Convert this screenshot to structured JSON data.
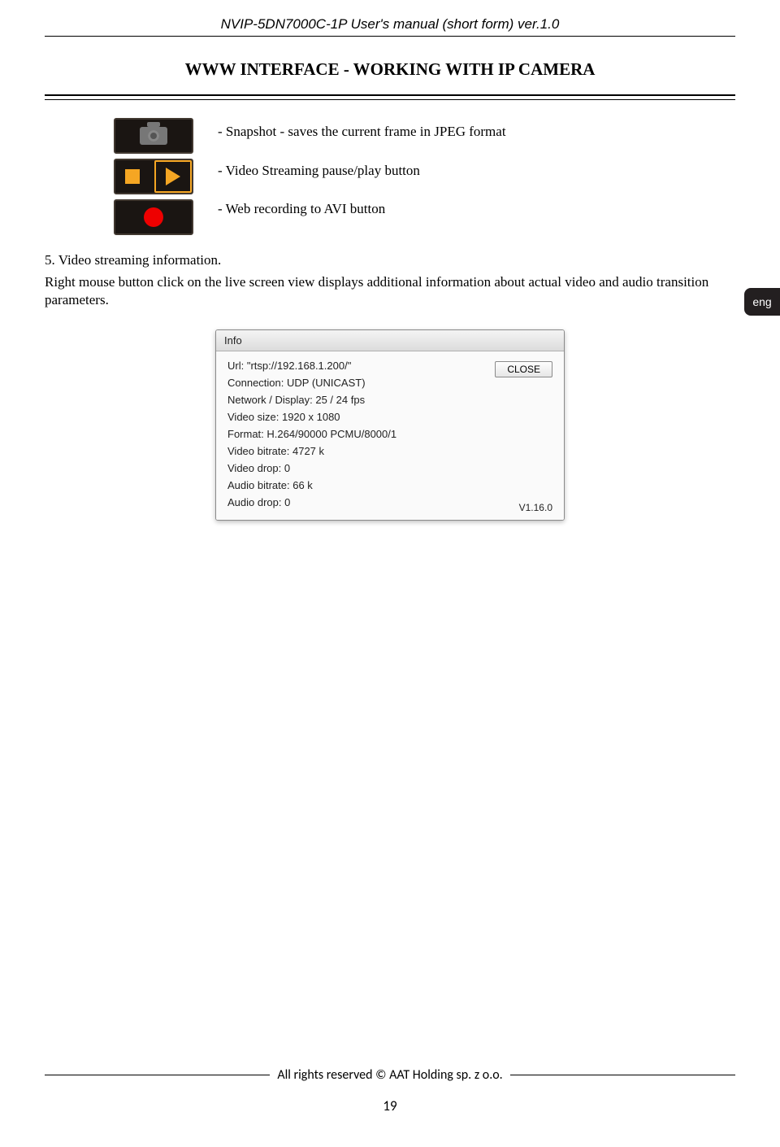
{
  "header": {
    "doc_title": "NVIP-5DN7000C-1P  User's manual (short form) ver.1.0",
    "section_title": "WWW INTERFACE - WORKING WITH IP CAMERA"
  },
  "icons": {
    "snapshot_desc": "- Snapshot - saves the current frame in JPEG format",
    "stream_desc": "- Video Streaming pause/play button",
    "record_desc": "- Web recording to AVI button"
  },
  "section5": {
    "heading": " 5.  Video streaming information.",
    "body": "Right mouse button click on the live screen view displays additional information about actual video and audio transition parameters."
  },
  "lang_tab": "eng",
  "info_box": {
    "title": "Info",
    "url": "Url: \"rtsp://192.168.1.200/\"",
    "connection": "Connection: UDP (UNICAST)",
    "network": "Network / Display:  25 / 24 fps",
    "video_size": "Video size: 1920 x 1080",
    "format": "Format: H.264/90000 PCMU/8000/1",
    "video_bitrate": "Video bitrate: 4727 k",
    "video_drop": "Video drop: 0",
    "audio_bitrate": "Audio bitrate: 66 k",
    "audio_drop": "Audio drop: 0",
    "close_label": "CLOSE",
    "version": "V1.16.0"
  },
  "footer": {
    "rights": "All rights reserved © AAT Holding sp. z o.o.",
    "page": "19"
  }
}
